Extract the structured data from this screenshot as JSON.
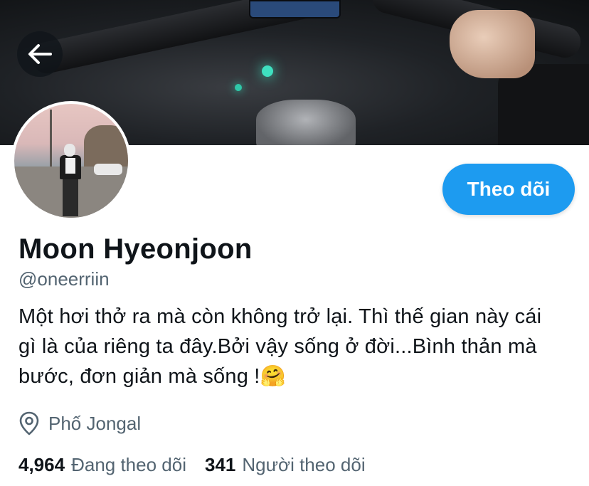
{
  "header": {
    "back_icon": "arrow-left-icon"
  },
  "profile": {
    "display_name": "Moon Hyeonjoon",
    "handle": "@oneerriin",
    "follow_label": "Theo dõi",
    "bio": "Một hơi thở ra mà còn không trở lại. Thì thế gian này cái gì là của riêng ta đây.Bởi vậy sống ở đời...Bình thản mà bước, đơn giản mà sống !🤗",
    "location_icon": "location-pin-icon",
    "location": "Phố Jongal",
    "following_count": "4,964",
    "following_label": "Đang theo dõi",
    "followers_count": "341",
    "followers_label": "Người theo dõi"
  },
  "colors": {
    "accent": "#1d9bf0",
    "primary_text": "#0f1419",
    "secondary_text": "#536471"
  }
}
